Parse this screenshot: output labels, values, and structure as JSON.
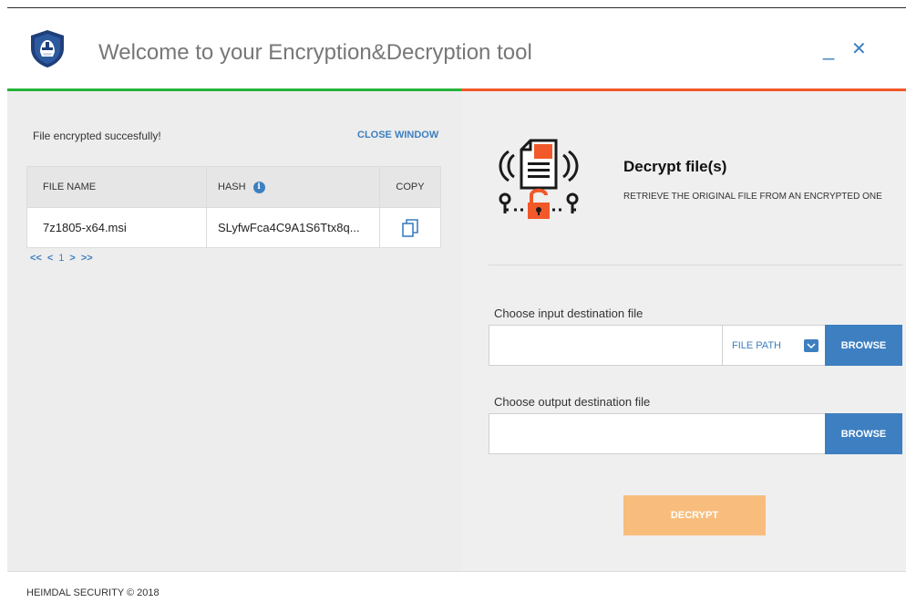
{
  "header": {
    "title": "Welcome to your Encryption&Decryption tool",
    "minimize_label": "_",
    "close_label": "✕"
  },
  "colors": {
    "accent_blue": "#3d7fc1",
    "bar_green": "#26b33a",
    "bar_orange": "#f1592a",
    "decrypt_button": "#f8bd7c"
  },
  "left": {
    "status": "File encrypted succesfully!",
    "close_window": "CLOSE WINDOW",
    "table": {
      "columns": [
        "FILE NAME",
        "HASH",
        "COPY"
      ],
      "rows": [
        {
          "file_name": "7z1805-x64.msi",
          "hash": "SLyfwFca4C9A1S6Ttx8q..."
        }
      ]
    },
    "pager": {
      "first": "<<",
      "prev": "<",
      "current": "1",
      "next": ">",
      "last": ">>"
    }
  },
  "right": {
    "title": "Decrypt file(s)",
    "subtitle": "RETRIEVE THE ORIGINAL FILE FROM AN ENCRYPTED ONE",
    "input_label": "Choose input destination file",
    "input_value": "",
    "file_path_label": "FILE PATH",
    "browse_label": "BROWSE",
    "output_label": "Choose output destination file",
    "output_value": "",
    "decrypt_label": "DECRYPT"
  },
  "footer": {
    "text": "HEIMDAL SECURITY  © 2018"
  },
  "icons": {
    "logo": "heimdal-helmet-shield-icon",
    "info": "info-icon",
    "copy": "copy-icon",
    "chevron": "chevron-down-icon",
    "illustration": "locked-document-icon"
  }
}
